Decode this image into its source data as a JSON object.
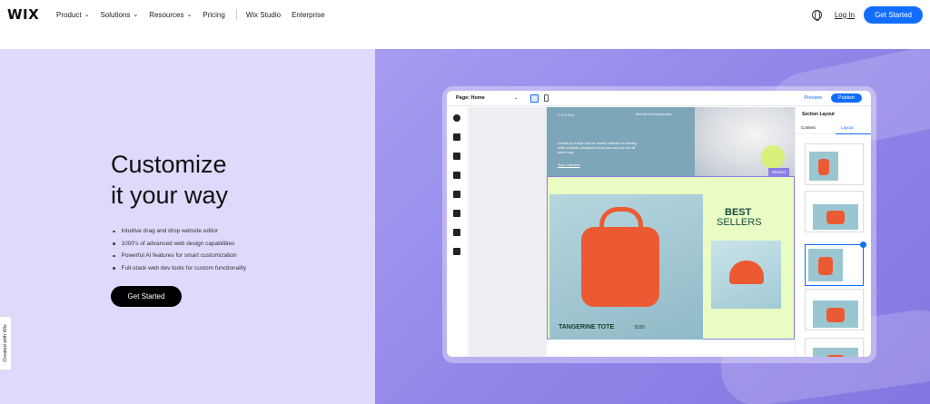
{
  "nav": {
    "logo": "WIX",
    "items": [
      {
        "label": "Product",
        "has_dropdown": true
      },
      {
        "label": "Solutions",
        "has_dropdown": true
      },
      {
        "label": "Resources",
        "has_dropdown": true
      },
      {
        "label": "Pricing",
        "has_dropdown": false
      }
    ],
    "secondary": [
      "Wix Studio",
      "Enterprise"
    ],
    "login": "Log In",
    "cta": "Get Started"
  },
  "hero": {
    "headline_line1": "Customize",
    "headline_line2": "it your way",
    "bullets": [
      "Intuitive drag and drop website editor",
      "1000's of advanced web design capabilities",
      "Powerful AI features for smart customization",
      "Full-stack web dev tools for custom functionality"
    ],
    "cta": "Get Started",
    "created_with": "Created with Wix"
  },
  "editor": {
    "page_selector": "Page: Home",
    "preview": "Preview",
    "publish": "Publish",
    "section_tag": "Section",
    "panel_title": "Section Layout",
    "panel_tabs": [
      "Content",
      "Layout"
    ],
    "site": {
      "brand": "FORMA",
      "nav": "Men   Women   Accessories",
      "intro": "A make-up in style with our newest collection of trending puffer products, designed to keep you cozy and chic all winter long.",
      "link": "Shop Collection",
      "best": "BEST",
      "sellers": "SELLERS",
      "product_title": "TANGERINE TOTE",
      "product_price": "$150"
    }
  },
  "colors": {
    "accent": "#116dff",
    "hero_left_bg": "#e0d9fb",
    "hero_right_bg": "#9387ea",
    "product_orange": "#ec5a33",
    "section_green": "#e8fcc4"
  }
}
